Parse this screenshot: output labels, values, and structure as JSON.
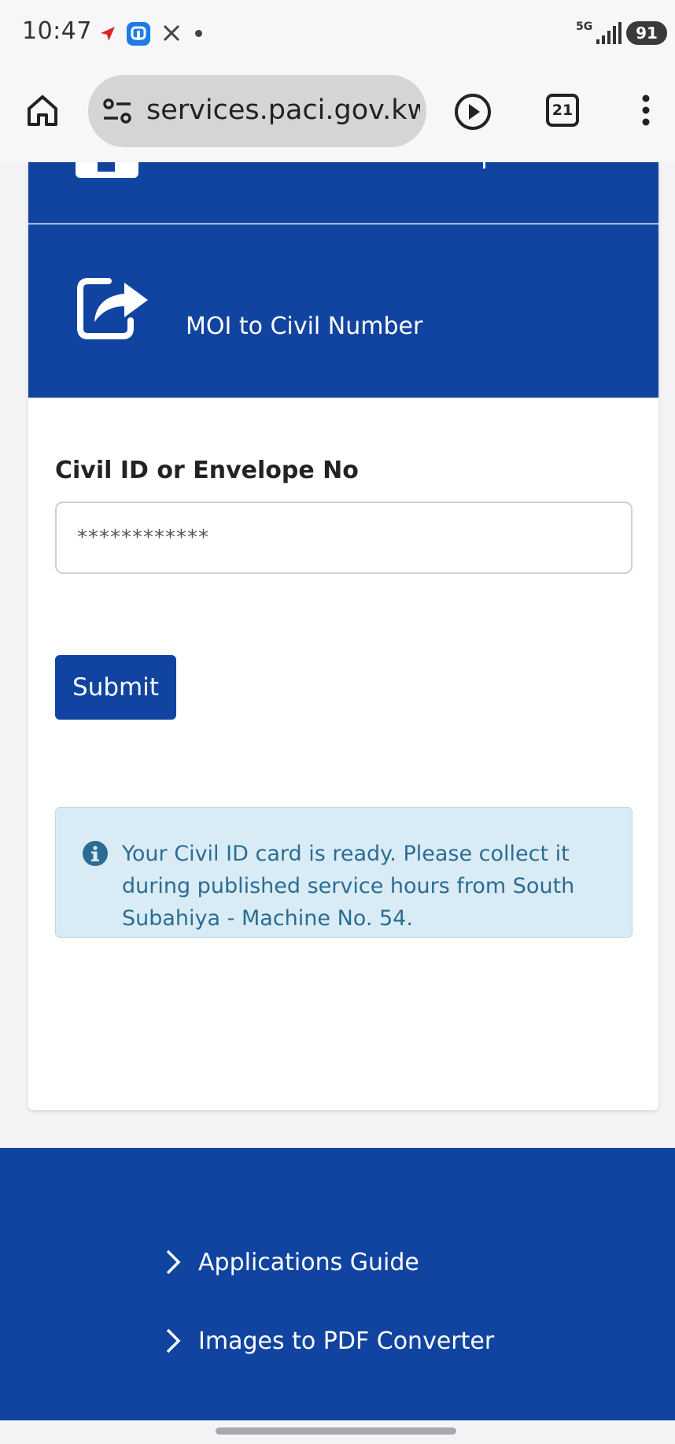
{
  "status_bar": {
    "time": "10:47",
    "icons": [
      "navigation-arrow-icon",
      "app-badge-icon",
      "x-icon",
      "dot-icon"
    ],
    "network_top": "5G",
    "battery": "91"
  },
  "browser": {
    "url": "services.paci.gov.kw",
    "tab_count": "21",
    "icons": [
      "home-icon",
      "tune-icon",
      "play-icon",
      "tabs-icon",
      "more-vert-icon"
    ]
  },
  "service": {
    "title": "MOI to Civil Number",
    "icon": "share-arrow-icon"
  },
  "form": {
    "label": "Civil ID or Envelope No",
    "input_value": "************",
    "submit_label": "Submit"
  },
  "alert": {
    "icon": "info-icon",
    "message": "Your Civil ID card is ready. Please collect it during published service hours from South Subahiya - Machine No. 54."
  },
  "footer": {
    "links": [
      {
        "label": "Applications Guide"
      },
      {
        "label": "Images to PDF Converter"
      }
    ]
  },
  "colors": {
    "primary": "#1144a0",
    "alert_bg": "#d9ecf5",
    "alert_text": "#2b6c94"
  }
}
